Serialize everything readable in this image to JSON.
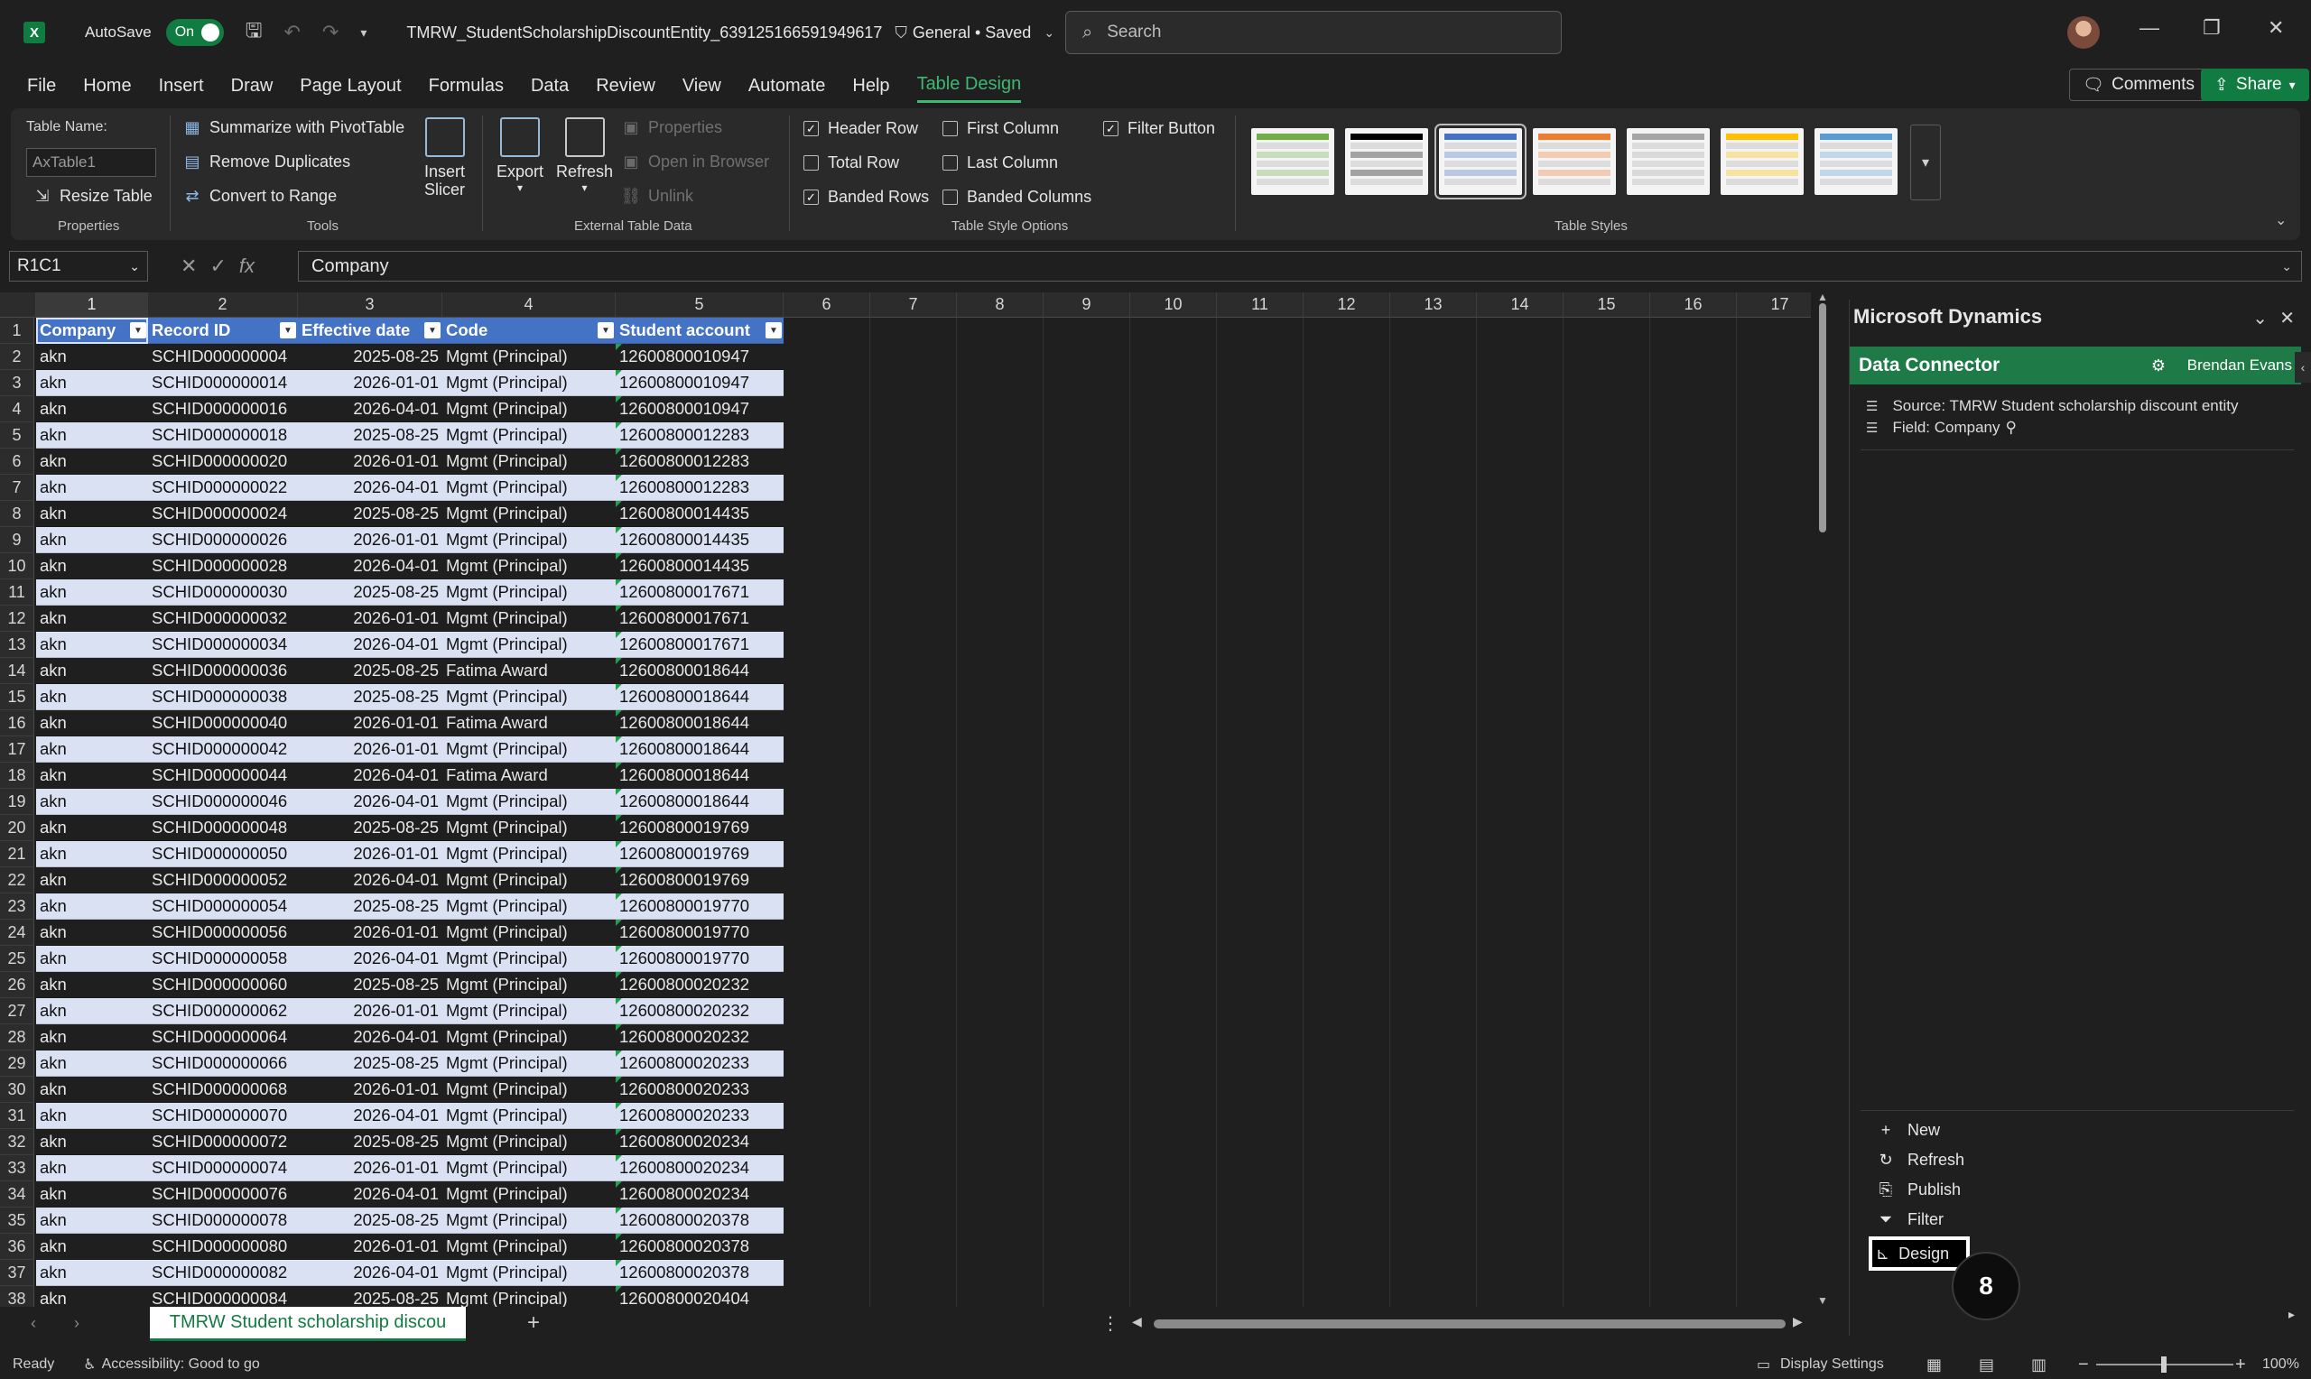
{
  "titlebar": {
    "autosave_label": "AutoSave",
    "autosave_state": "On",
    "filename": "TMRW_StudentScholarshipDiscountEntity_639125166591949617",
    "sensitivity": "General • Saved",
    "search_placeholder": "Search"
  },
  "menu": {
    "tabs": [
      "File",
      "Home",
      "Insert",
      "Draw",
      "Page Layout",
      "Formulas",
      "Data",
      "Review",
      "View",
      "Automate",
      "Help",
      "Table Design"
    ],
    "active_tab": "Table Design",
    "comments_label": "Comments",
    "share_label": "Share"
  },
  "ribbon": {
    "table_name_label": "Table Name:",
    "table_name_value": "AxTable1",
    "resize_table": "Resize Table",
    "group_properties": "Properties",
    "summarize_pivot": "Summarize with PivotTable",
    "remove_duplicates": "Remove Duplicates",
    "convert_range": "Convert to Range",
    "group_tools": "Tools",
    "insert_slicer_1": "Insert",
    "insert_slicer_2": "Slicer",
    "export": "Export",
    "refresh": "Refresh",
    "properties": "Properties",
    "open_browser": "Open in Browser",
    "unlink": "Unlink",
    "group_external": "External Table Data",
    "header_row": "Header Row",
    "total_row": "Total Row",
    "banded_rows": "Banded Rows",
    "first_column": "First Column",
    "last_column": "Last Column",
    "banded_columns": "Banded Columns",
    "filter_button": "Filter Button",
    "group_style_options": "Table Style Options",
    "group_styles": "Table Styles",
    "swatch_colors": [
      "#70ad47",
      "#000000",
      "#4472c4",
      "#ed7d31",
      "#a5a5a5",
      "#ffc000",
      "#5b9bd5"
    ]
  },
  "formula": {
    "name_box": "R1C1",
    "value": "Company"
  },
  "grid": {
    "col_headers": [
      "1",
      "2",
      "3",
      "4",
      "5",
      "6",
      "7",
      "8",
      "9",
      "10",
      "11",
      "12",
      "13",
      "14",
      "15",
      "16",
      "17"
    ],
    "table_headers": [
      "Company",
      "Record ID",
      "Effective date",
      "Code",
      "Student account"
    ],
    "rows": [
      [
        "akn",
        "SCHID000000004",
        "2025-08-25",
        "Mgmt (Principal)",
        "12600800010947"
      ],
      [
        "akn",
        "SCHID000000014",
        "2026-01-01",
        "Mgmt (Principal)",
        "12600800010947"
      ],
      [
        "akn",
        "SCHID000000016",
        "2026-04-01",
        "Mgmt (Principal)",
        "12600800010947"
      ],
      [
        "akn",
        "SCHID000000018",
        "2025-08-25",
        "Mgmt (Principal)",
        "12600800012283"
      ],
      [
        "akn",
        "SCHID000000020",
        "2026-01-01",
        "Mgmt (Principal)",
        "12600800012283"
      ],
      [
        "akn",
        "SCHID000000022",
        "2026-04-01",
        "Mgmt (Principal)",
        "12600800012283"
      ],
      [
        "akn",
        "SCHID000000024",
        "2025-08-25",
        "Mgmt (Principal)",
        "12600800014435"
      ],
      [
        "akn",
        "SCHID000000026",
        "2026-01-01",
        "Mgmt (Principal)",
        "12600800014435"
      ],
      [
        "akn",
        "SCHID000000028",
        "2026-04-01",
        "Mgmt (Principal)",
        "12600800014435"
      ],
      [
        "akn",
        "SCHID000000030",
        "2025-08-25",
        "Mgmt (Principal)",
        "12600800017671"
      ],
      [
        "akn",
        "SCHID000000032",
        "2026-01-01",
        "Mgmt (Principal)",
        "12600800017671"
      ],
      [
        "akn",
        "SCHID000000034",
        "2026-04-01",
        "Mgmt (Principal)",
        "12600800017671"
      ],
      [
        "akn",
        "SCHID000000036",
        "2025-08-25",
        "Fatima Award",
        "12600800018644"
      ],
      [
        "akn",
        "SCHID000000038",
        "2025-08-25",
        "Mgmt (Principal)",
        "12600800018644"
      ],
      [
        "akn",
        "SCHID000000040",
        "2026-01-01",
        "Fatima Award",
        "12600800018644"
      ],
      [
        "akn",
        "SCHID000000042",
        "2026-01-01",
        "Mgmt (Principal)",
        "12600800018644"
      ],
      [
        "akn",
        "SCHID000000044",
        "2026-04-01",
        "Fatima Award",
        "12600800018644"
      ],
      [
        "akn",
        "SCHID000000046",
        "2026-04-01",
        "Mgmt (Principal)",
        "12600800018644"
      ],
      [
        "akn",
        "SCHID000000048",
        "2025-08-25",
        "Mgmt (Principal)",
        "12600800019769"
      ],
      [
        "akn",
        "SCHID000000050",
        "2026-01-01",
        "Mgmt (Principal)",
        "12600800019769"
      ],
      [
        "akn",
        "SCHID000000052",
        "2026-04-01",
        "Mgmt (Principal)",
        "12600800019769"
      ],
      [
        "akn",
        "SCHID000000054",
        "2025-08-25",
        "Mgmt (Principal)",
        "12600800019770"
      ],
      [
        "akn",
        "SCHID000000056",
        "2026-01-01",
        "Mgmt (Principal)",
        "12600800019770"
      ],
      [
        "akn",
        "SCHID000000058",
        "2026-04-01",
        "Mgmt (Principal)",
        "12600800019770"
      ],
      [
        "akn",
        "SCHID000000060",
        "2025-08-25",
        "Mgmt (Principal)",
        "12600800020232"
      ],
      [
        "akn",
        "SCHID000000062",
        "2026-01-01",
        "Mgmt (Principal)",
        "12600800020232"
      ],
      [
        "akn",
        "SCHID000000064",
        "2026-04-01",
        "Mgmt (Principal)",
        "12600800020232"
      ],
      [
        "akn",
        "SCHID000000066",
        "2025-08-25",
        "Mgmt (Principal)",
        "12600800020233"
      ],
      [
        "akn",
        "SCHID000000068",
        "2026-01-01",
        "Mgmt (Principal)",
        "12600800020233"
      ],
      [
        "akn",
        "SCHID000000070",
        "2026-04-01",
        "Mgmt (Principal)",
        "12600800020233"
      ],
      [
        "akn",
        "SCHID000000072",
        "2025-08-25",
        "Mgmt (Principal)",
        "12600800020234"
      ],
      [
        "akn",
        "SCHID000000074",
        "2026-01-01",
        "Mgmt (Principal)",
        "12600800020234"
      ],
      [
        "akn",
        "SCHID000000076",
        "2026-04-01",
        "Mgmt (Principal)",
        "12600800020234"
      ],
      [
        "akn",
        "SCHID000000078",
        "2025-08-25",
        "Mgmt (Principal)",
        "12600800020378"
      ],
      [
        "akn",
        "SCHID000000080",
        "2026-01-01",
        "Mgmt (Principal)",
        "12600800020378"
      ],
      [
        "akn",
        "SCHID000000082",
        "2026-04-01",
        "Mgmt (Principal)",
        "12600800020378"
      ],
      [
        "akn",
        "SCHID000000084",
        "2025-08-25",
        "Mgmt (Principal)",
        "12600800020404"
      ]
    ]
  },
  "sheet": {
    "tab_label": "TMRW Student scholarship discou",
    "add_label": "+"
  },
  "status": {
    "ready": "Ready",
    "accessibility": "Accessibility: Good to go",
    "display_settings": "Display Settings",
    "zoom": "100%"
  },
  "panel": {
    "title": "Microsoft Dynamics",
    "connector_title": "Data Connector",
    "user": "Brendan Evans",
    "source": "Source: TMRW Student scholarship discount entity",
    "field": "Field: Company",
    "actions": [
      "New",
      "Refresh",
      "Publish",
      "Filter",
      "Design"
    ],
    "step_number": "8"
  }
}
